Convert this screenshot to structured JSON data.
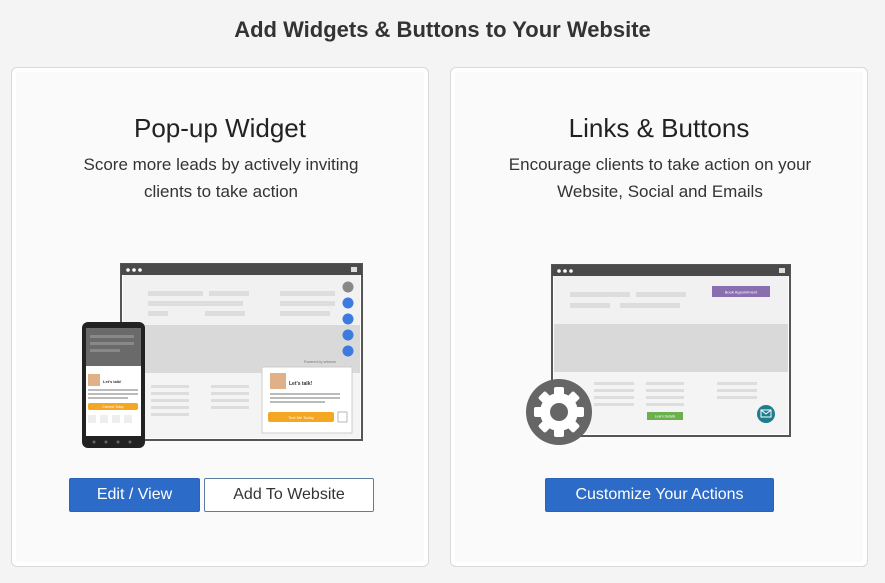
{
  "page": {
    "title": "Add Widgets & Buttons to Your Website"
  },
  "popup_card": {
    "title": "Pop-up Widget",
    "description": "Score more leads by actively inviting clients to take action",
    "edit_button": "Edit / View",
    "add_button": "Add To Website",
    "illustration": {
      "chat_bubble_title": "Let's talk!",
      "cta_label": "Text Me Today",
      "powered_by": "Powered by setmore",
      "phone_bubble_title": "Let's talk!",
      "phone_cta_label": "Connect Today"
    }
  },
  "links_card": {
    "title": "Links & Buttons",
    "description": "Encourage clients to take action on your Website, Social and Emails",
    "customize_button": "Customize Your Actions",
    "illustration": {
      "book_button_label": "Book Appointment",
      "small_button_label": "Learn Details"
    }
  },
  "colors": {
    "primary": "#2d6bc8",
    "accent_orange": "#f5a623",
    "accent_purple": "#8a6fb0",
    "accent_green": "#6ab04c",
    "widget_blue": "#3b7be0",
    "mail_teal": "#1d7d8c"
  }
}
